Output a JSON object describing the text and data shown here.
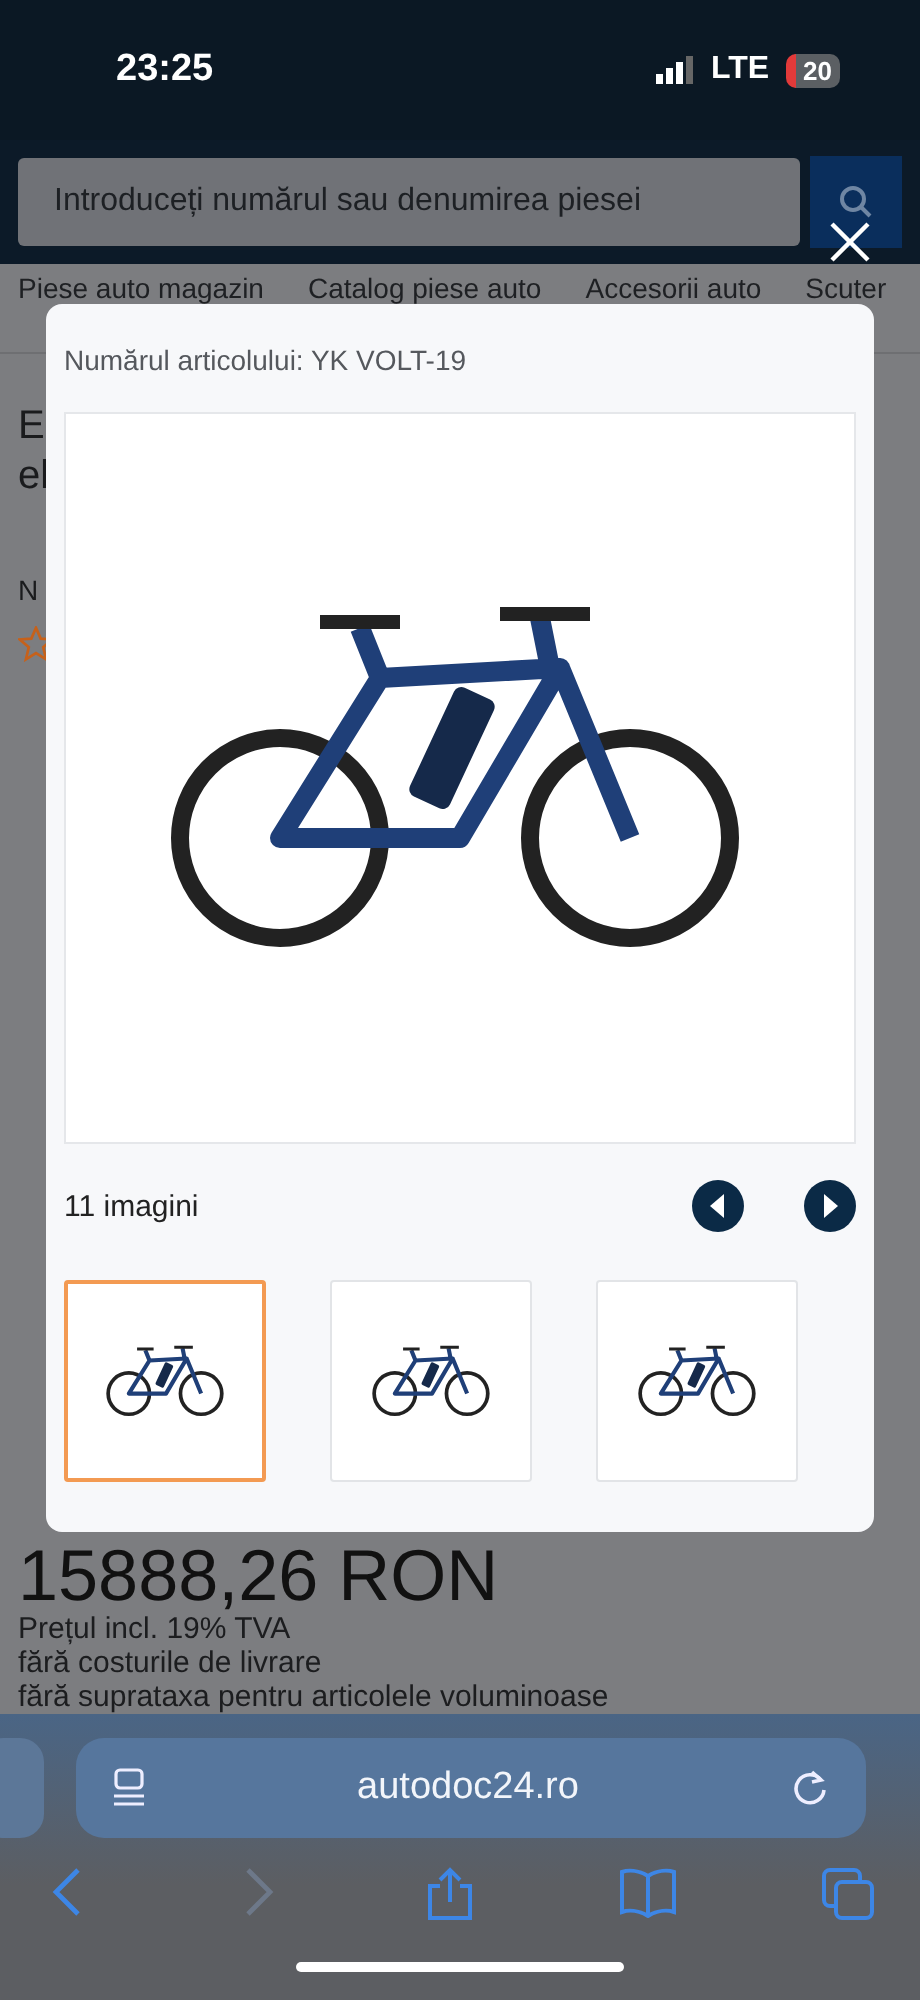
{
  "status_bar": {
    "time": "23:25",
    "network": "LTE",
    "battery": "20"
  },
  "search": {
    "placeholder": "Introduceți numărul sau denumirea piesei"
  },
  "nav": [
    "Piese auto magazin",
    "Catalog piese auto",
    "Accesorii auto",
    "Scuter"
  ],
  "page": {
    "fragments": [
      "E",
      "el",
      "N"
    ],
    "price": "15888,26 RON",
    "notes": [
      "Prețul incl. 19% TVA",
      "fără costurile de livrare",
      "fără suprataxa pentru articolele voluminoase"
    ]
  },
  "gallery": {
    "article": "Numărul articolului: YK VOLT-19",
    "count": "11 imagini",
    "thumbnails": [
      {
        "selected": true
      },
      {
        "selected": false
      },
      {
        "selected": false
      }
    ]
  },
  "browser": {
    "url": "autodoc24.ro"
  }
}
